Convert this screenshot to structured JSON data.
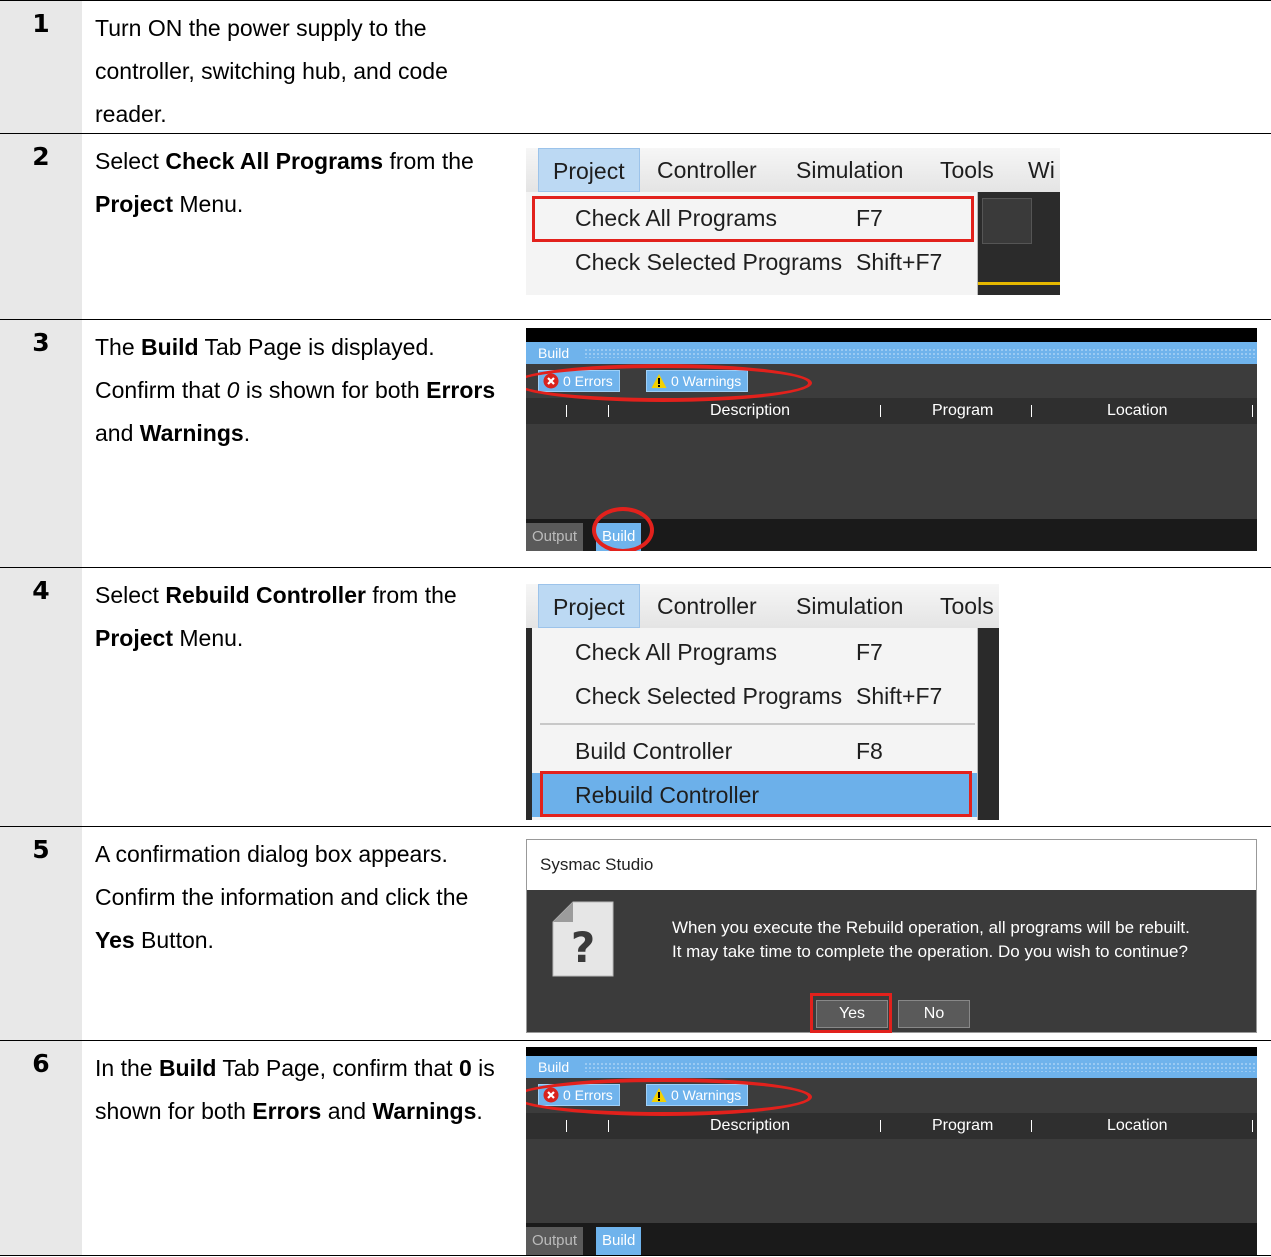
{
  "steps": [
    {
      "number": "1",
      "text_html": "Turn ON the power supply to the controller, switching hub, and code reader."
    },
    {
      "number": "2",
      "text_html": "Select <b>Check All Programs</b> from the <b>Project</b> Menu."
    },
    {
      "number": "3",
      "text_html": "The <b>Build</b> Tab Page is displayed.<br>Confirm that <i>0</i> is shown for both <b>Errors</b> and <b>Warnings</b>."
    },
    {
      "number": "4",
      "text_html": "Select <b>Rebuild Controller</b> from the <b>Project</b> Menu."
    },
    {
      "number": "5",
      "text_html": "A confirmation dialog box appears. Confirm the information and click the <b>Yes</b> Button."
    },
    {
      "number": "6",
      "text_html": "In the <b>Build</b> Tab Page, confirm that <b>0</b> is shown for both <b>Errors</b> and <b>Warnings</b>."
    }
  ],
  "menu2": {
    "menus": [
      "Project",
      "Controller",
      "Simulation",
      "Tools",
      "Wi"
    ],
    "items": [
      {
        "label": "Check All Programs",
        "shortcut": "F7"
      },
      {
        "label": "Check Selected Programs",
        "shortcut": "Shift+F7"
      }
    ]
  },
  "menu4": {
    "menus": [
      "Project",
      "Controller",
      "Simulation",
      "Tools"
    ],
    "items": [
      {
        "label": "Check All Programs",
        "shortcut": "F7"
      },
      {
        "label": "Check Selected Programs",
        "shortcut": "Shift+F7"
      },
      {
        "label": "Build Controller",
        "shortcut": "F8"
      },
      {
        "label": "Rebuild Controller",
        "shortcut": ""
      }
    ]
  },
  "build_panel": {
    "title": "Build",
    "errors": "0  Errors",
    "warnings": "0  Warnings",
    "columns": [
      "Description",
      "Program",
      "Location"
    ],
    "tabs": [
      "Output",
      "Build"
    ]
  },
  "dialog": {
    "title": "Sysmac Studio",
    "message_line1": "When you execute the Rebuild operation, all programs will be rebuilt.",
    "message_line2": "It may take time to complete the operation. Do you wish to continue?",
    "yes": "Yes",
    "no": "No"
  },
  "colors": {
    "highlight": "#e2211c",
    "accent": "#6fb3ec"
  }
}
